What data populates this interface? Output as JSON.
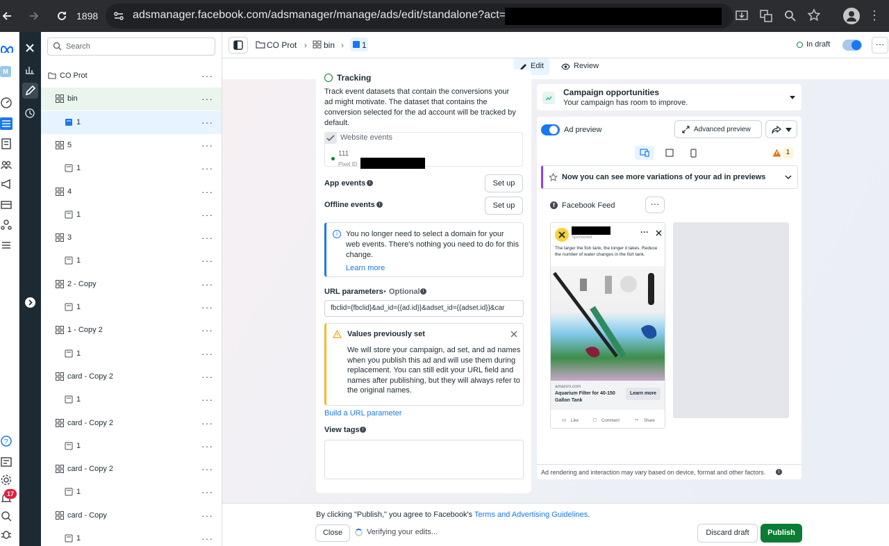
{
  "browser": {
    "tab_count": "1898",
    "url": "adsmanager.facebook.com/adsmanager/manage/ads/edit/standalone?act="
  },
  "sidebar_rail": {
    "notification_count": "17",
    "avatar_letter": "M"
  },
  "tree": {
    "search_placeholder": "Search",
    "items": [
      {
        "label": "CO Prot",
        "type": "campaign"
      },
      {
        "label": "bin",
        "type": "adset"
      },
      {
        "label": "1",
        "type": "ad"
      },
      {
        "label": "5",
        "type": "adset"
      },
      {
        "label": "1",
        "type": "ad"
      },
      {
        "label": "4",
        "type": "adset"
      },
      {
        "label": "1",
        "type": "ad"
      },
      {
        "label": "3",
        "type": "adset"
      },
      {
        "label": "1",
        "type": "ad"
      },
      {
        "label": "2 - Copy",
        "type": "adset"
      },
      {
        "label": "1",
        "type": "ad"
      },
      {
        "label": "1 - Copy 2",
        "type": "adset"
      },
      {
        "label": "1",
        "type": "ad"
      },
      {
        "label": "card - Copy 2",
        "type": "adset"
      },
      {
        "label": "1",
        "type": "ad"
      },
      {
        "label": "card - Copy 2",
        "type": "adset"
      },
      {
        "label": "1",
        "type": "ad"
      },
      {
        "label": "card - Copy 2",
        "type": "adset"
      },
      {
        "label": "1",
        "type": "ad"
      },
      {
        "label": "card - Copy",
        "type": "adset"
      },
      {
        "label": "1",
        "type": "ad"
      }
    ]
  },
  "topbar": {
    "breadcrumb_campaign": "CO Prot",
    "breadcrumb_adset": "bin",
    "breadcrumb_ad": "1",
    "status": "In draft"
  },
  "modes": {
    "edit": "Edit",
    "review": "Review"
  },
  "tracking": {
    "heading": "Tracking",
    "description": "Track event datasets that contain the conversions your ad might motivate. The dataset that contains the conversion selected for the ad account will be tracked by default.",
    "website_events_label": "Website events",
    "pixel_name": "111",
    "pixel_id_label": "Pixel ID",
    "app_events_label": "App events",
    "offline_events_label": "Offline events",
    "setup_label": "Set up",
    "domain_notice": "You no longer need to select a domain for your web events. There's nothing you need to do for this change.",
    "learn_more": "Learn more",
    "url_params_label": "URL parameters",
    "url_params_optional": "Optional",
    "url_params_value": "fbclid={fbclid}&ad_id={{ad.id}}&adset_id={{adset.id}}&car",
    "values_title": "Values previously set",
    "values_body": "We will store your campaign, ad set, and ad names when you publish this ad and will use them during replacement. You can still edit your URL field and names after publishing, but they will always refer to the original names.",
    "build_url": "Build a URL parameter",
    "view_tags": "View tags"
  },
  "opportunities": {
    "title": "Campaign opportunities",
    "subtitle": "Your campaign has room to improve."
  },
  "preview": {
    "ad_preview_label": "Ad preview",
    "advanced_preview": "Advanced preview",
    "warning_count": "1",
    "variations_banner": "Now you can see more variations of your ad in previews",
    "placement": "Facebook Feed",
    "sponsored": "Sponsored",
    "ad_text": "The larger the fish tank, the longer it takes. Reduce the number of water changes in the fish tank.",
    "link_domain": "amazon.com",
    "link_title": "Aquarium Filter for 40-150 Gallon Tank",
    "cta": "Learn more",
    "like": "Like",
    "comment": "Comment",
    "share": "Share",
    "disclaimer": "Ad rendering and interaction may vary based on device, format and other factors."
  },
  "footer": {
    "agree_prefix": "By clicking \"Publish,\" you agree to Facebook's ",
    "terms_link": "Terms and Advertising Guidelines",
    "agree_suffix": ".",
    "close": "Close",
    "verifying": "Verifying your edits...",
    "discard": "Discard draft",
    "publish": "Publish"
  },
  "colors": {
    "brand_blue": "#1877f2",
    "publish_green": "#0a7c34",
    "selected_row": "#e7f3ff",
    "parent_row": "#eaf5ed",
    "warning": "#f7b928"
  }
}
